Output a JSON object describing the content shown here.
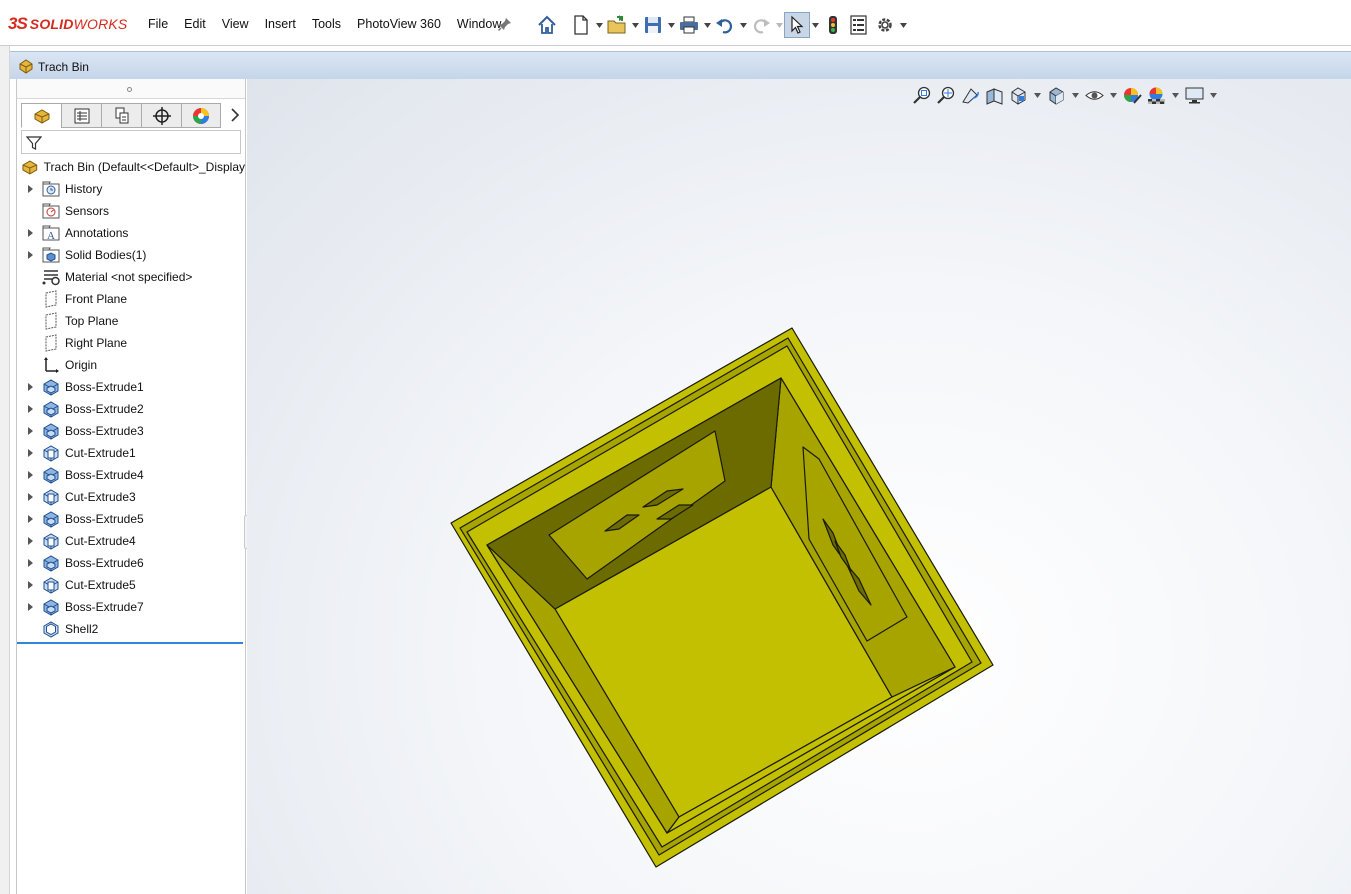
{
  "app": {
    "logo_ds": "3S",
    "logo_solid": "SOLID",
    "logo_works": "WORKS",
    "brand_color": "#d52b1e"
  },
  "menu": [
    "File",
    "Edit",
    "View",
    "Insert",
    "Tools",
    "PhotoView 360",
    "Window"
  ],
  "toolbar": {
    "icons": [
      "home-icon",
      "new-document-icon",
      "open-icon",
      "save-icon",
      "print-icon",
      "undo-icon",
      "redo-icon",
      "select-icon",
      "rebuild-traffic-light-icon",
      "file-properties-icon",
      "options-gear-icon"
    ]
  },
  "document": {
    "title": "Trach Bin"
  },
  "feature_manager": {
    "tabs": [
      "feature-tree-tab",
      "property-manager-tab",
      "configuration-manager-tab",
      "dimxpert-tab",
      "display-manager-tab"
    ],
    "root_label": "Trach Bin  (Default<<Default>_Display",
    "items": [
      {
        "label": "History",
        "icon": "history-folder-icon",
        "expandable": true
      },
      {
        "label": "Sensors",
        "icon": "sensors-folder-icon",
        "expandable": false
      },
      {
        "label": "Annotations",
        "icon": "annotations-folder-icon",
        "expandable": true
      },
      {
        "label": "Solid Bodies(1)",
        "icon": "solid-bodies-folder-icon",
        "expandable": true
      },
      {
        "label": "Material <not specified>",
        "icon": "material-icon",
        "expandable": false
      },
      {
        "label": "Front Plane",
        "icon": "plane-icon",
        "expandable": false
      },
      {
        "label": "Top Plane",
        "icon": "plane-icon",
        "expandable": false
      },
      {
        "label": "Right Plane",
        "icon": "plane-icon",
        "expandable": false
      },
      {
        "label": "Origin",
        "icon": "origin-icon",
        "expandable": false
      },
      {
        "label": "Boss-Extrude1",
        "icon": "boss-extrude-icon",
        "expandable": true
      },
      {
        "label": "Boss-Extrude2",
        "icon": "boss-extrude-icon",
        "expandable": true
      },
      {
        "label": "Boss-Extrude3",
        "icon": "boss-extrude-icon",
        "expandable": true
      },
      {
        "label": "Cut-Extrude1",
        "icon": "cut-extrude-icon",
        "expandable": true
      },
      {
        "label": "Boss-Extrude4",
        "icon": "boss-extrude-icon",
        "expandable": true
      },
      {
        "label": "Cut-Extrude3",
        "icon": "cut-extrude-icon",
        "expandable": true
      },
      {
        "label": "Boss-Extrude5",
        "icon": "boss-extrude-icon",
        "expandable": true
      },
      {
        "label": "Cut-Extrude4",
        "icon": "cut-extrude-icon",
        "expandable": true
      },
      {
        "label": "Boss-Extrude6",
        "icon": "boss-extrude-icon",
        "expandable": true
      },
      {
        "label": "Cut-Extrude5",
        "icon": "cut-extrude-icon",
        "expandable": true
      },
      {
        "label": "Boss-Extrude7",
        "icon": "boss-extrude-icon",
        "expandable": true
      },
      {
        "label": "Shell2",
        "icon": "shell-icon",
        "expandable": false
      }
    ]
  },
  "heads_up": {
    "icons": [
      "zoom-to-fit-icon",
      "zoom-to-area-icon",
      "previous-view-icon",
      "section-view-icon",
      "view-orientation-icon",
      "display-style-icon",
      "hide-show-items-icon",
      "edit-appearance-icon",
      "apply-scene-icon",
      "view-settings-icon"
    ]
  },
  "model": {
    "color_light": "#c2c000",
    "color_mid": "#a7a400",
    "color_dark": "#6c6b00",
    "edge_color": "#1a1a00"
  }
}
